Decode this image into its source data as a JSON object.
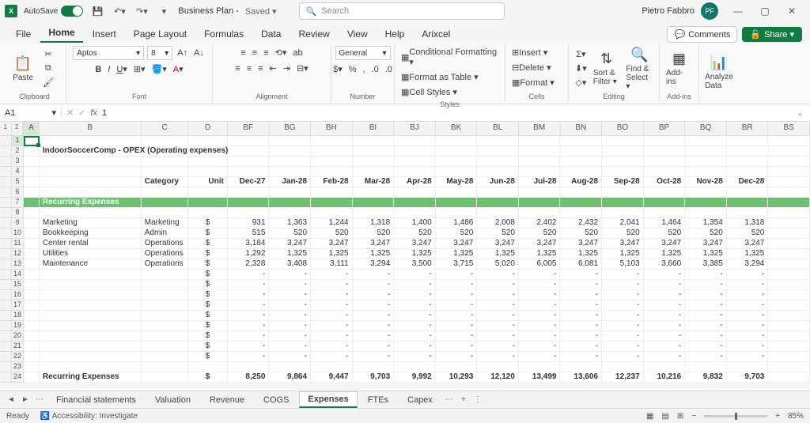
{
  "title_bar": {
    "autosave": "AutoSave",
    "doc_name": "Business Plan - ",
    "saved": "Saved ▾",
    "search_ph": "Search",
    "user_name": "Pietro Fabbro",
    "user_initials": "PF"
  },
  "tabs": {
    "file": "File",
    "home": "Home",
    "insert": "Insert",
    "page_layout": "Page Layout",
    "formulas": "Formulas",
    "data": "Data",
    "review": "Review",
    "view": "View",
    "help": "Help",
    "arixcel": "Arixcel",
    "comments": "Comments",
    "share": "Share ▾"
  },
  "ribbon": {
    "clipboard": "Clipboard",
    "paste": "Paste",
    "font": "Font",
    "font_name": "Aptos",
    "font_size": "8",
    "alignment": "Alignment",
    "number": "Number",
    "number_fmt": "General",
    "styles": "Styles",
    "cond_fmt": "Conditional Formatting ▾",
    "as_table": "Format as Table ▾",
    "cell_styles": "Cell Styles ▾",
    "cells": "Cells",
    "insert": "Insert ▾",
    "delete": "Delete ▾",
    "format": "Format ▾",
    "editing": "Editing",
    "sort": "Sort & Filter ▾",
    "find": "Find & Select ▾",
    "addins": "Add-ins",
    "addins_btn": "Add-ins",
    "analyze": "Analyze Data"
  },
  "name_box": "A1",
  "formula": "1",
  "sheet": {
    "title": "IndoorSoccerComp - OPEX (Operating expenses)",
    "category_hdr": "Category",
    "unit_hdr": "Unit",
    "months": [
      "Dec-27",
      "Jan-28",
      "Feb-28",
      "Mar-28",
      "Apr-28",
      "May-28",
      "Jun-28",
      "Jul-28",
      "Aug-28",
      "Sep-28",
      "Oct-28",
      "Nov-28",
      "Dec-28"
    ],
    "section": "Recurring Expenses",
    "rows": [
      {
        "name": "Marketing",
        "cat": "Marketing",
        "unit": "$",
        "v": [
          "931",
          "1,363",
          "1,244",
          "1,318",
          "1,400",
          "1,486",
          "2,008",
          "2,402",
          "2,432",
          "2,041",
          "1,464",
          "1,354",
          "1,318"
        ]
      },
      {
        "name": "Bookkeeping",
        "cat": "Admin",
        "unit": "$",
        "v": [
          "515",
          "520",
          "520",
          "520",
          "520",
          "520",
          "520",
          "520",
          "520",
          "520",
          "520",
          "520",
          "520"
        ]
      },
      {
        "name": "Center rental",
        "cat": "Operations",
        "unit": "$",
        "v": [
          "3,184",
          "3,247",
          "3,247",
          "3,247",
          "3,247",
          "3,247",
          "3,247",
          "3,247",
          "3,247",
          "3,247",
          "3,247",
          "3,247",
          "3,247"
        ]
      },
      {
        "name": "Utilities",
        "cat": "Operations",
        "unit": "$",
        "v": [
          "1,292",
          "1,325",
          "1,325",
          "1,325",
          "1,325",
          "1,325",
          "1,325",
          "1,325",
          "1,325",
          "1,325",
          "1,325",
          "1,325",
          "1,325"
        ]
      },
      {
        "name": "Maintenance",
        "cat": "Operations",
        "unit": "$",
        "v": [
          "2,328",
          "3,408",
          "3,111",
          "3,294",
          "3,500",
          "3,715",
          "5,020",
          "6,005",
          "6,081",
          "5,103",
          "3,660",
          "3,385",
          "3,294"
        ]
      }
    ],
    "blank": {
      "unit": "$",
      "dash": "-"
    },
    "total_label": "Recurring Expenses",
    "total_unit": "$",
    "totals": [
      "8,250",
      "9,864",
      "9,447",
      "9,703",
      "9,992",
      "10,293",
      "12,120",
      "13,499",
      "13,606",
      "12,237",
      "10,216",
      "9,832",
      "9,703"
    ]
  },
  "cols": [
    "A",
    "B",
    "C",
    "D",
    "BF",
    "BG",
    "BH",
    "BI",
    "BJ",
    "BK",
    "BL",
    "BM",
    "BN",
    "BO",
    "BP",
    "BQ",
    "BR",
    "BS"
  ],
  "row_nums": [
    "1",
    "2",
    "3",
    "4",
    "5",
    "6",
    "7",
    "8",
    "9",
    "10",
    "11",
    "12",
    "13",
    "14",
    "15",
    "16",
    "17",
    "18",
    "19",
    "20",
    "21",
    "22",
    "23",
    "24"
  ],
  "sheet_tabs": {
    "t0": "Financial statements",
    "t1": "Valuation",
    "t2": "Revenue",
    "t3": "COGS",
    "t4": "Expenses",
    "t5": "FTEs",
    "t6": "Capex"
  },
  "status": {
    "ready": "Ready",
    "access": "Accessibility: Investigate",
    "zoom": "85%"
  }
}
